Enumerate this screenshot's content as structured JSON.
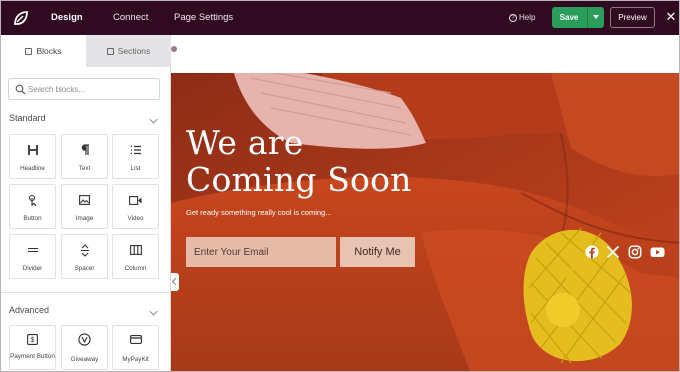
{
  "topbar": {
    "nav": [
      "Design",
      "Connect",
      "Page Settings"
    ],
    "help_label": "Help",
    "save_label": "Save",
    "preview_label": "Preview",
    "close_glyph": "✕"
  },
  "sidebar": {
    "tabs": [
      "Blocks",
      "Sections"
    ],
    "search_placeholder": "Search blocks...",
    "standard": {
      "title": "Standard",
      "blocks": [
        {
          "label": "Headline",
          "icon": "heading-icon"
        },
        {
          "label": "Text",
          "icon": "paragraph-icon"
        },
        {
          "label": "List",
          "icon": "list-icon"
        },
        {
          "label": "Button",
          "icon": "button-icon"
        },
        {
          "label": "Image",
          "icon": "image-icon"
        },
        {
          "label": "Video",
          "icon": "video-icon"
        },
        {
          "label": "Divider",
          "icon": "divider-icon"
        },
        {
          "label": "Spacer",
          "icon": "spacer-icon"
        },
        {
          "label": "Column",
          "icon": "column-icon"
        }
      ]
    },
    "advanced": {
      "title": "Advanced",
      "blocks": [
        {
          "label": "Payment Button",
          "icon": "payment-icon"
        },
        {
          "label": "Giveaway",
          "icon": "giveaway-icon"
        },
        {
          "label": "MyPayKit",
          "icon": "card-icon"
        }
      ]
    }
  },
  "hero": {
    "headline_line1": "We are",
    "headline_line2": "Coming Soon",
    "subtext": "Get ready something really cool is coming...",
    "email_placeholder": "Enter Your Email",
    "notify_label": "Notify Me",
    "socials": [
      "facebook-icon",
      "x-icon",
      "instagram-icon",
      "youtube-icon"
    ]
  },
  "colors": {
    "topbar": "#2f0a21",
    "save_green": "#2a9d5b",
    "sofa": "#b9401c"
  }
}
